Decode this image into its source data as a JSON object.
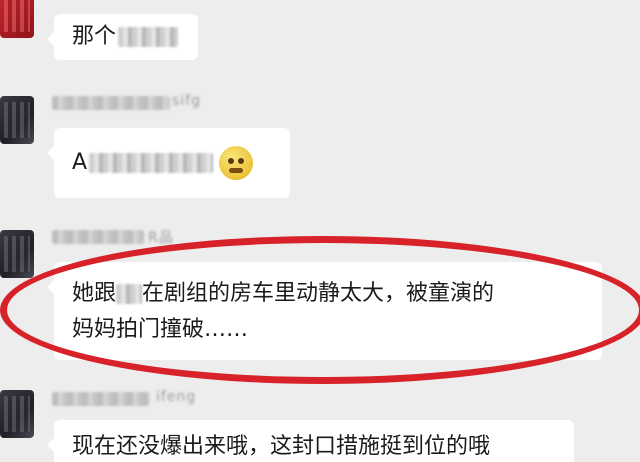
{
  "messages": [
    {
      "text_prefix": "那个",
      "has_redaction": true
    },
    {
      "sender_hint": "sifg",
      "text_prefix": "A",
      "has_redaction": true,
      "emoji": "grimacing-emoji"
    },
    {
      "sender_hint": "R品",
      "line1_prefix": "她跟",
      "line1_suffix": "在剧组的房车里动静太大，被童演的",
      "line2": "妈妈拍门撞破……",
      "highlighted": true
    },
    {
      "sender_hint": "ifeng",
      "text": "现在还没爆出来哦，这封口措施挺到位的哦"
    }
  ],
  "colors": {
    "background": "#ededed",
    "bubble": "#ffffff",
    "highlight_ring": "#d8222a",
    "avatar_first": "#c8282e"
  }
}
